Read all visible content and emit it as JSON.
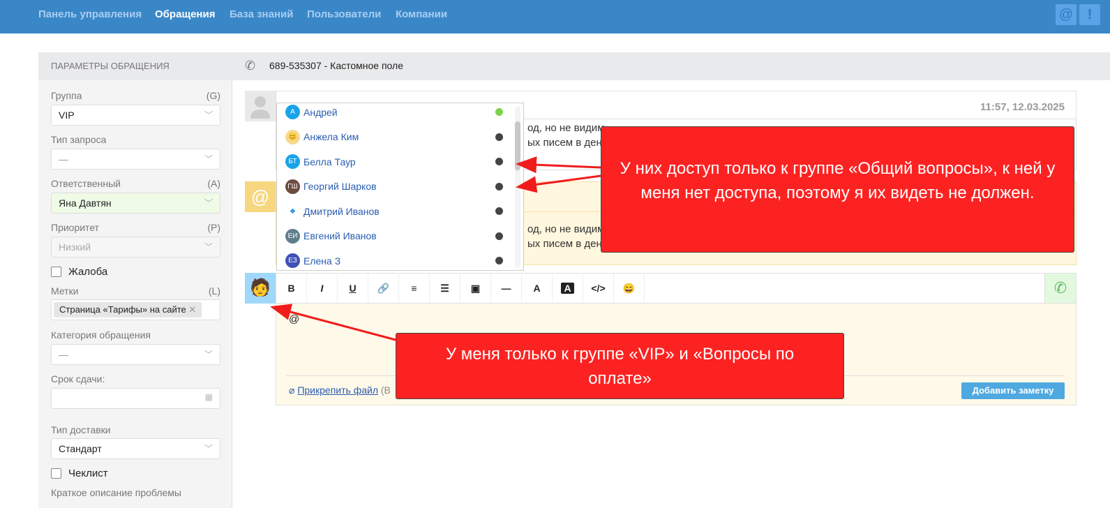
{
  "nav": {
    "items": [
      "Панель управления",
      "Обращения",
      "База знаний",
      "Пользователи",
      "Компании"
    ],
    "active": "Обращения"
  },
  "top_icons": {
    "mention": "@",
    "alert": "!"
  },
  "sidebar": {
    "title": "ПАРАМЕТРЫ ОБРАЩЕНИЯ",
    "group": {
      "label": "Группа",
      "key": "(G)",
      "value": "VIP"
    },
    "request_type": {
      "label": "Тип запроса",
      "value": "—"
    },
    "assignee": {
      "label": "Ответственный",
      "key": "(A)",
      "value": "Яна Давтян"
    },
    "priority": {
      "label": "Приоритет",
      "key": "(P)",
      "value": "Низкий"
    },
    "complaint": {
      "label": "Жалоба"
    },
    "tags": {
      "label": "Метки",
      "key": "(L)",
      "value": "Страница «Тарифы» на сайте",
      "remove": "✕"
    },
    "category": {
      "label": "Категория обращения",
      "value": "—"
    },
    "deadline": {
      "label": "Срок сдачи:",
      "value": ""
    },
    "delivery": {
      "label": "Тип доставки",
      "value": "Стандарт"
    },
    "checklist": {
      "label": "Чеклист"
    },
    "short_desc": {
      "label": "Краткое описание проблемы"
    }
  },
  "ticket": {
    "header": "689-535307 - Кастомное поле"
  },
  "messages": [
    {
      "time": "11:57, 12.03.2025",
      "line1": "од, но не видим",
      "line2": "ых писем в ден"
    },
    {
      "avatar": "@",
      "line1": "од, но не видим",
      "line2": "ых писем в ден"
    }
  ],
  "mention_dropdown": [
    {
      "initials": "А",
      "name": "Андрей",
      "color": "#1aa3e8",
      "online": true
    },
    {
      "initials": "😊",
      "name": "Анжела Ким",
      "color": "#f7d98a",
      "online": false
    },
    {
      "initials": "БТ",
      "name": "Белла Таур",
      "color": "#1aa3e8",
      "online": false
    },
    {
      "initials": "ГШ",
      "name": "Георгий Шарков",
      "color": "#6d4c41",
      "online": false
    },
    {
      "initials": "◆",
      "name": "Дмитрий Иванов",
      "color": "#ffffff",
      "online": false
    },
    {
      "initials": "ЕИ",
      "name": "Евгений Иванов",
      "color": "#5f7d8a",
      "online": false
    },
    {
      "initials": "ЕЗ",
      "name": "Елена З",
      "color": "#3f51b5",
      "online": false
    }
  ],
  "editor": {
    "toolbar": [
      "B",
      "I",
      "U",
      "🔗",
      "≡",
      "☰",
      "▣",
      "—",
      "A",
      "A",
      "</>",
      "😄"
    ],
    "content": "@",
    "attach_label": "Прикрепить файл",
    "attach_suffix": "(В",
    "submit": "Добавить заметку"
  },
  "callouts": {
    "top": "У них доступ только к группе «Общий вопросы», к ней у меня нет доступа, поэтому я их видеть не должен.",
    "bottom": "У меня только к группе «VIP» и «Вопросы по оплате»"
  },
  "colors": {
    "accent": "#3a87c8",
    "callout": "#fd2222",
    "online": "#7ed24a"
  }
}
